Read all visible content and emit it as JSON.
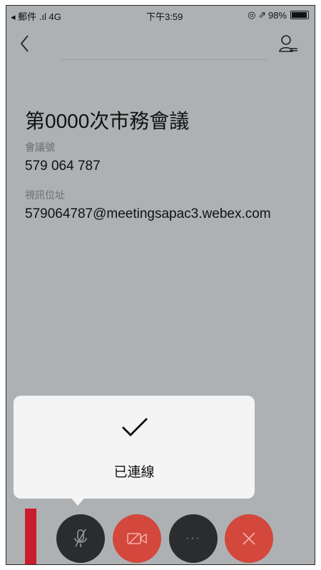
{
  "status_bar": {
    "carrier": "◂ 郵件 .ıl 4G",
    "time": "下午3:59",
    "battery": "98%",
    "extra": "◎ ⇗"
  },
  "meeting": {
    "title": "第0000次市務會議",
    "meeting_number_label": "會議號",
    "meeting_number": "579 064 787",
    "video_address_label": "視訊位址",
    "video_address": "579064787@meetingsapac3.webex.com"
  },
  "toast": {
    "message": "已連線"
  },
  "controls": {
    "more_label": "···"
  },
  "colors": {
    "background": "#aeb1b3",
    "end_call": "#d3473d",
    "dark_button": "#2a2c2e",
    "accent_bar": "#c91c2c"
  },
  "icons": [
    "back-chevron-icon",
    "participants-icon",
    "checkmark-icon",
    "mic-muted-icon",
    "video-off-icon",
    "more-icon",
    "close-icon"
  ]
}
